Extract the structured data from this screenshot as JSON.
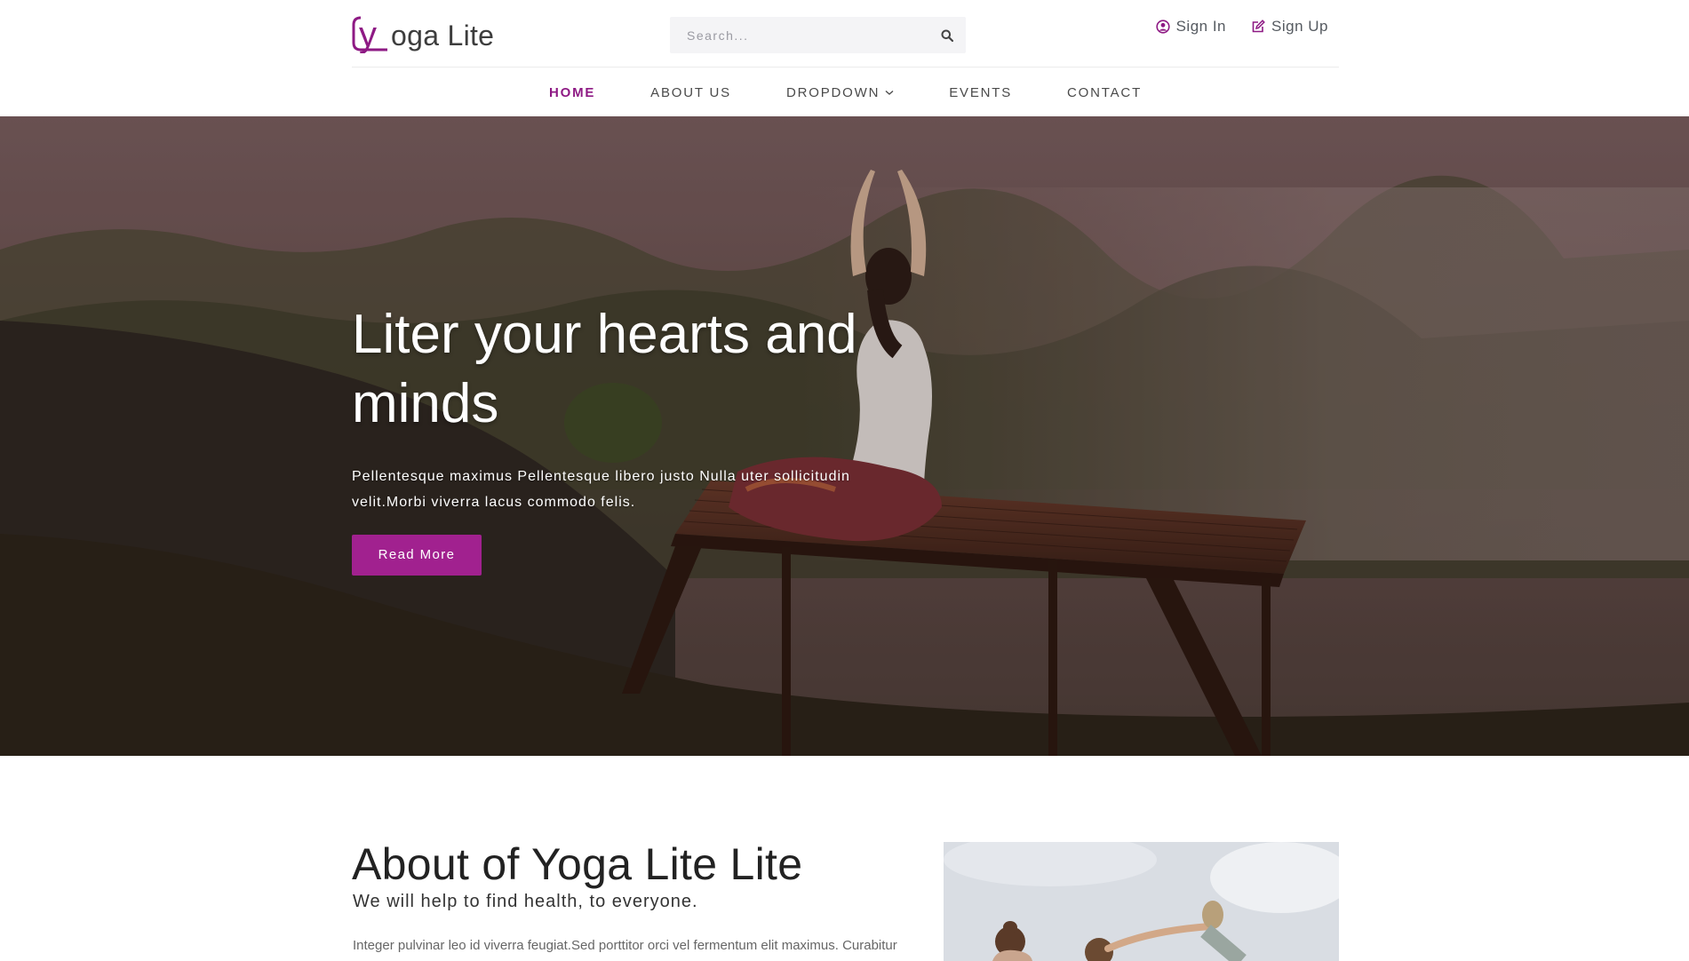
{
  "brand": {
    "logo_text": "oga Lite",
    "logo_mark": "Y",
    "accent_color": "#a1218f"
  },
  "search": {
    "placeholder": "Search...",
    "icon": "search-icon"
  },
  "auth": {
    "sign_in": "Sign In",
    "sign_in_icon": "user-circle-icon",
    "sign_up": "Sign Up",
    "sign_up_icon": "edit-icon"
  },
  "nav": {
    "items": [
      {
        "label": "HOME",
        "active": true
      },
      {
        "label": "ABOUT US"
      },
      {
        "label": "DROPDOWN",
        "dropdown": true
      },
      {
        "label": "EVENTS"
      },
      {
        "label": "CONTACT"
      }
    ]
  },
  "hero": {
    "title": "Liter your hearts and minds",
    "text": "Pellentesque maximus Pellentesque libero justo Nulla uter sollicitudin velit.Morbi viverra lacus commodo felis.",
    "button": "Read More"
  },
  "about": {
    "title": "About of Yoga Lite Lite",
    "subtitle": "We will help to find health, to everyone.",
    "text": "Integer pulvinar leo id viverra feugiat.Sed porttitor orci vel fermentum elit maximus. Curabitur"
  }
}
